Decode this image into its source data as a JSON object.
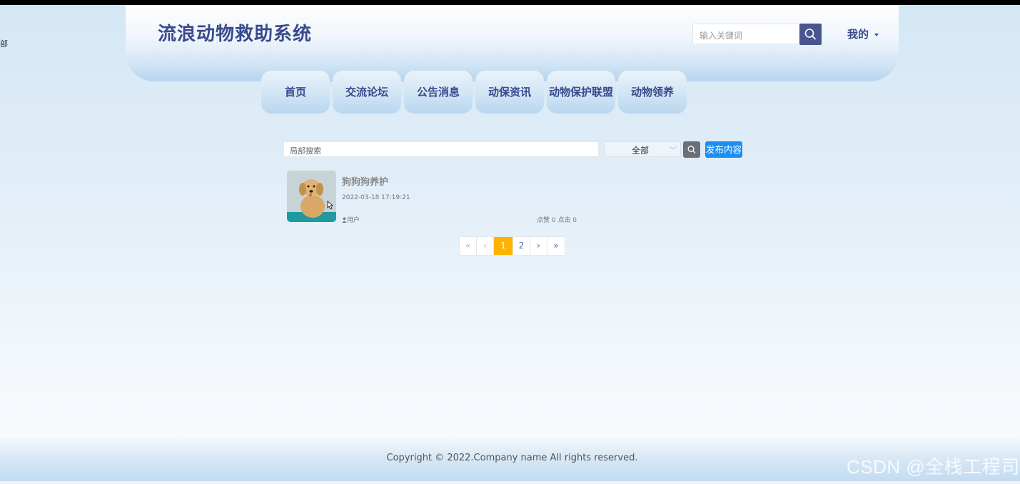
{
  "left_clip": "部",
  "header": {
    "title": "流浪动物救助系统",
    "search_placeholder": "输入关键词",
    "my_menu": "我的"
  },
  "nav": [
    {
      "label": "首页"
    },
    {
      "label": "交流论坛"
    },
    {
      "label": "公告消息"
    },
    {
      "label": "动保资讯"
    },
    {
      "label": "动物保护联盟"
    },
    {
      "label": "动物领养"
    }
  ],
  "filter": {
    "placeholder": "局部搜索",
    "select_value": "全部",
    "publish_label": "发布内容"
  },
  "post": {
    "title": "狗狗狗养护",
    "date": "2022-03-18 17:19:21",
    "author": "用户",
    "stats": "点赞 0 点击 0"
  },
  "pagination": {
    "first": "«",
    "prev": "‹",
    "pages": [
      "1",
      "2"
    ],
    "current": "1",
    "next": "›",
    "last": "»"
  },
  "footer": {
    "copyright": "Copyright © 2022.Company name All rights reserved."
  },
  "watermark": "CSDN @全栈工程司",
  "colors": {
    "brand": "#3a4a8c",
    "accent_page": "#ffb300",
    "publish": "#1f8ef1"
  }
}
